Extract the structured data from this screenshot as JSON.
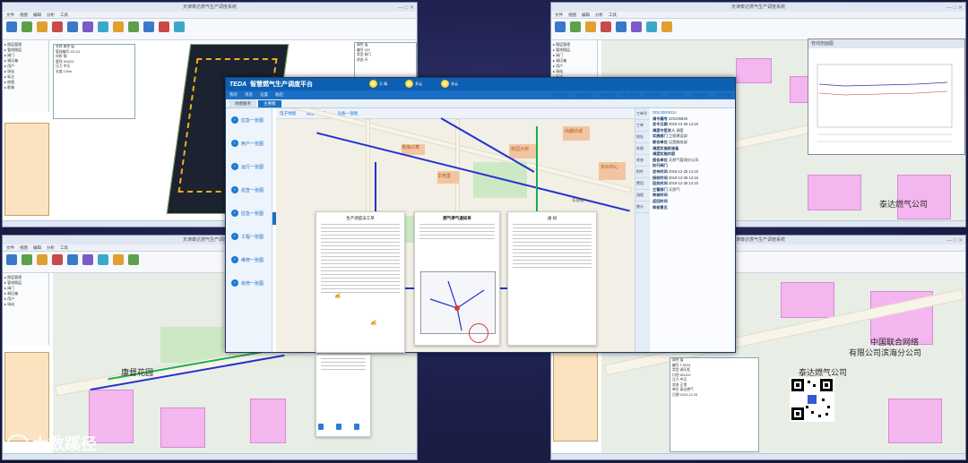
{
  "main_window": {
    "logo": "TEDA",
    "title": "智慧燃气生产调度平台",
    "menu": [
      "我的",
      "消息",
      "设置",
      "收起"
    ],
    "weather": [
      {
        "temp": "天 晴"
      },
      {
        "temp": "多云"
      },
      {
        "temp": "多云"
      }
    ],
    "top_menu": [
      "气源场景",
      "场站场景",
      "管线管理",
      "用户管理",
      "运检管理",
      "综合管理",
      "设备管理",
      "用户管理"
    ],
    "tabs": [
      "地图服务",
      "主要图"
    ],
    "sidebar": [
      "应急一张图",
      "用户一张图",
      "运行一张图",
      "巡查一张图",
      "应急一张图",
      "工程一张图",
      "维修一张图",
      "抢修一张图"
    ],
    "map_toolbar": [
      "电子地图",
      "高度一张图",
      "设备一张图"
    ],
    "map_labels": [
      "南海公寓",
      "华苑里",
      "侨园大桥",
      "尚都欣城",
      "京州中心",
      "卫津南路",
      "东丽路"
    ],
    "right_panel": {
      "tabs": [
        "工单号",
        "工单",
        "地址",
        "处理",
        "状态",
        "附件",
        "费用",
        "流程",
        "统计"
      ],
      "order_id": "DDL00009114",
      "rows": [
        {
          "k": "调令编号",
          "v": "220105839"
        },
        {
          "k": "发令日期",
          "v": "2019-12-25 14:16"
        },
        {
          "k": "调度令签发人",
          "v": "调度"
        },
        {
          "k": "实施部门",
          "v": "工程建设部"
        },
        {
          "k": "联合单位",
          "v": "运营服务部"
        },
        {
          "k": "调度实施前准备",
          "v": ""
        },
        {
          "k": "调度实施内容",
          "v": ""
        },
        {
          "k": "报告单位",
          "v": "天然气管网分公司"
        },
        {
          "k": "执行阀门",
          "v": ""
        },
        {
          "k": "发布时间",
          "v": "2019-12-25 14:16"
        },
        {
          "k": "接收时间",
          "v": "2019-12-25 14:16"
        },
        {
          "k": "回执时间",
          "v": "2019-12-25 14:16"
        },
        {
          "k": "主管部门",
          "v": "天然气"
        },
        {
          "k": "审核时间",
          "v": ""
        },
        {
          "k": "返回时间",
          "v": ""
        },
        {
          "k": "审核意见",
          "v": ""
        }
      ]
    },
    "docs": {
      "doc1_title": "生产调度派工单",
      "doc2_title": "燃气停气通知单",
      "doc3_title": "通 知"
    }
  },
  "background_windows": {
    "top_left_title": "天津泰达燃气生产调度系统",
    "top_right_title": "天津泰达燃气生产调度系统",
    "bottom_left_title": "天津泰达燃气生产调度系统",
    "bottom_right_title": "天津泰达燃气生产调度系统",
    "map_labels": [
      "康督花园",
      "泰达燃气公司",
      "中国联合网络",
      "有限公司滨海分公司",
      "泰达燃气公司"
    ],
    "chart_title": "管线剖面图"
  },
  "watermark": {
    "text": "大数蹊径"
  },
  "colors": {
    "header_blue": "#0d5fb1",
    "building_pink": "#f3b6ef",
    "pipe_blue": "#2233cc",
    "pipe_green": "#17b04a"
  }
}
